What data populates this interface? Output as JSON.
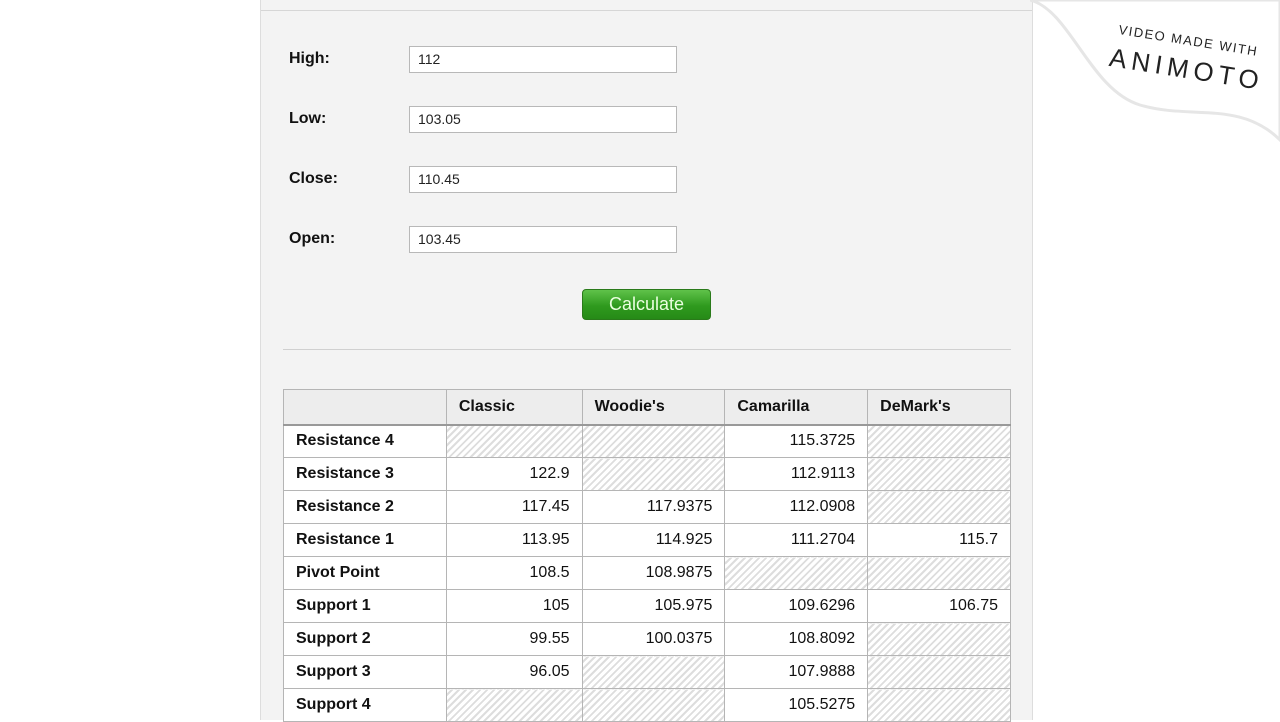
{
  "form": {
    "fields": [
      {
        "label": "High:",
        "value": "112"
      },
      {
        "label": "Low:",
        "value": "103.05"
      },
      {
        "label": "Close:",
        "value": "110.45"
      },
      {
        "label": "Open:",
        "value": "103.45"
      }
    ],
    "calculate_label": "Calculate"
  },
  "table": {
    "headers": [
      "",
      "Classic",
      "Woodie's",
      "Camarilla",
      "DeMark's"
    ],
    "rows": [
      {
        "label": "Resistance 4",
        "values": [
          null,
          null,
          "115.3725",
          null
        ]
      },
      {
        "label": "Resistance 3",
        "values": [
          "122.9",
          null,
          "112.9113",
          null
        ]
      },
      {
        "label": "Resistance 2",
        "values": [
          "117.45",
          "117.9375",
          "112.0908",
          null
        ]
      },
      {
        "label": "Resistance 1",
        "values": [
          "113.95",
          "114.925",
          "111.2704",
          "115.7"
        ]
      },
      {
        "label": "Pivot Point",
        "values": [
          "108.5",
          "108.9875",
          null,
          null
        ]
      },
      {
        "label": "Support 1",
        "values": [
          "105",
          "105.975",
          "109.6296",
          "106.75"
        ]
      },
      {
        "label": "Support 2",
        "values": [
          "99.55",
          "100.0375",
          "108.8092",
          null
        ]
      },
      {
        "label": "Support 3",
        "values": [
          "96.05",
          null,
          "107.9888",
          null
        ]
      },
      {
        "label": "Support 4",
        "values": [
          null,
          null,
          "105.5275",
          null
        ]
      }
    ]
  },
  "watermark": {
    "line1": "VIDEO MADE WITH",
    "line2": "ANIMOTO"
  }
}
